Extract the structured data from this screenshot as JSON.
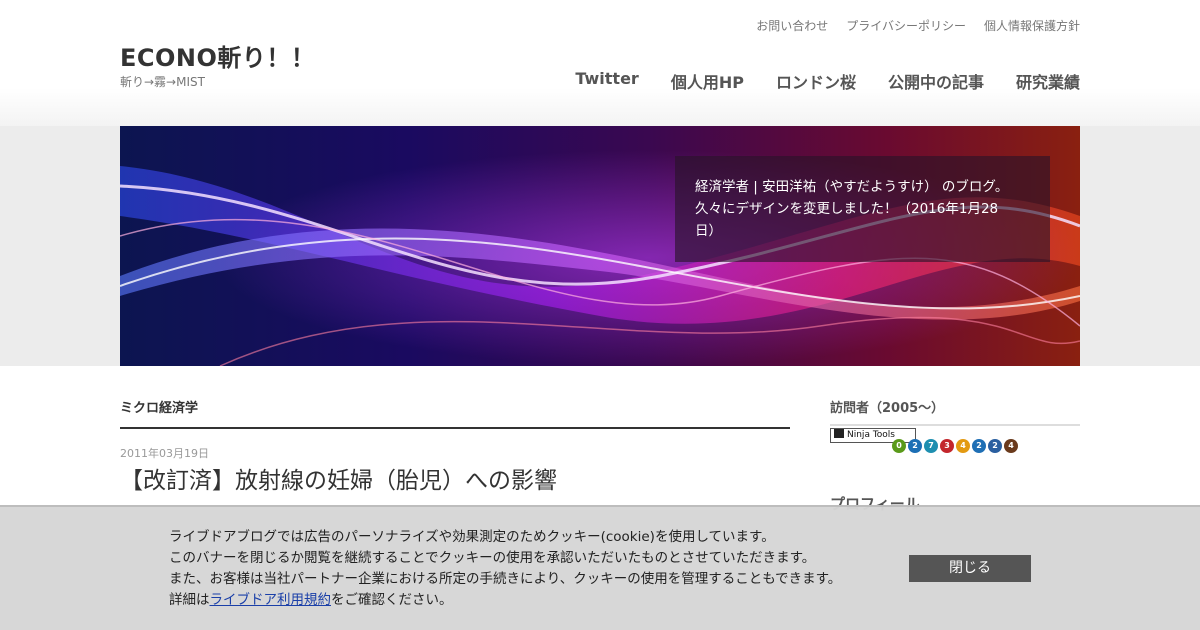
{
  "site": {
    "title": "ECONO斬り！！",
    "description": "斬り→霧→MIST"
  },
  "top_links": [
    "お問い合わせ",
    "プライバシーポリシー",
    "個人情報保護方針"
  ],
  "main_nav": [
    "Twitter",
    "個人用HP",
    "ロンドン桜",
    "公開中の記事",
    "研究業績"
  ],
  "hero": {
    "line1": "経済学者 | 安田洋祐（やすだようすけ） のブログ。",
    "line2": "久々にデザインを変更しました！（2016年1月28",
    "line3": "日）"
  },
  "main": {
    "category_title": "ミクロ経済学",
    "post_date": "2011年03月19日",
    "post_title": "【改訂済】放射線の妊婦（胎児）への影響"
  },
  "sidebar": {
    "visitors_title": "訪問者（2005～）",
    "ninja_badge": "Ninja Tools",
    "counter_digits": [
      "0",
      "2",
      "7",
      "3",
      "4",
      "2",
      "2",
      "4"
    ],
    "counter_colors": [
      "#5a9a1a",
      "#1c6fb5",
      "#1e8fb0",
      "#c3262c",
      "#e39a12",
      "#1f6fb5",
      "#2a5fa0",
      "#6a3a1c"
    ],
    "profile_title": "プロフィール"
  },
  "cookie": {
    "line1": "ライブドアブログでは広告のパーソナライズや効果測定のためクッキー(cookie)を使用しています。",
    "line2": "このバナーを閉じるか閲覧を継続することでクッキーの使用を承認いただいたものとさせていただきます。",
    "line3": "また、お客様は当社パートナー企業における所定の手続きにより、クッキーの使用を管理することもできます。",
    "line4_prefix": "詳細は",
    "line4_link": "ライブドア利用規約",
    "line4_suffix": "をご確認ください。",
    "close_label": "閉じる"
  }
}
